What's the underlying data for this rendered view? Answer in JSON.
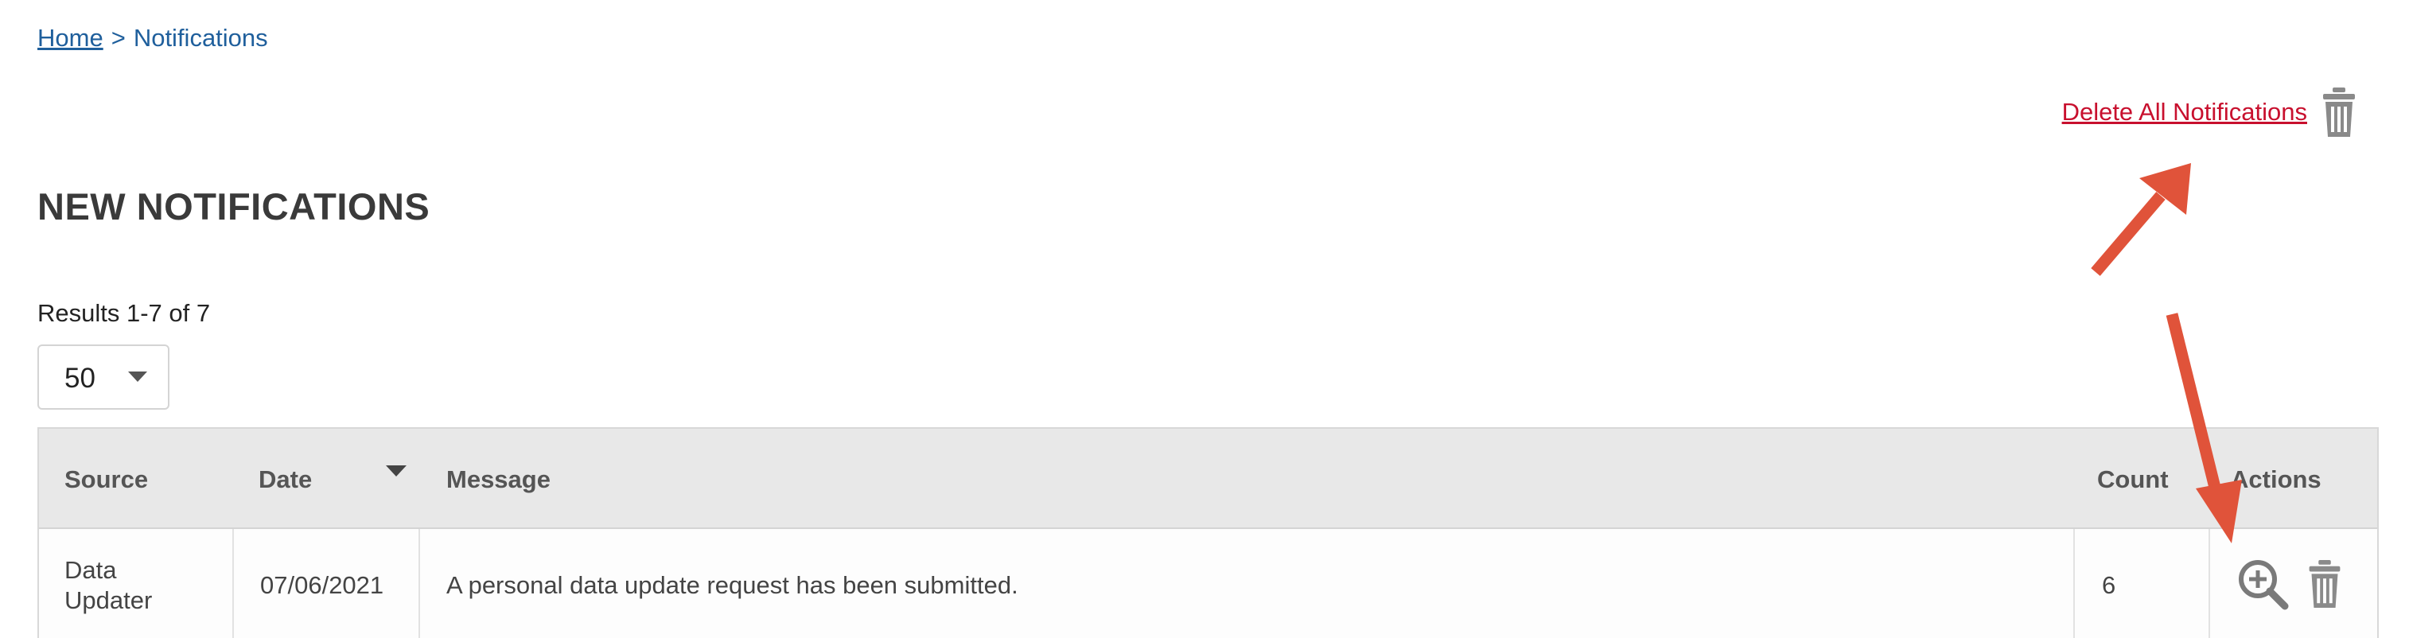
{
  "breadcrumb": {
    "home": "Home",
    "separator": ">",
    "current": "Notifications"
  },
  "delete_all_label": "Delete All Notifications",
  "page_title": "NEW NOTIFICATIONS",
  "results_text": "Results 1-7 of 7",
  "per_page": {
    "selected": "50"
  },
  "table": {
    "headers": {
      "source": "Source",
      "date": "Date",
      "message": "Message",
      "count": "Count",
      "actions": "Actions"
    },
    "rows": [
      {
        "source_line1": "Data",
        "source_line2": "Updater",
        "date": "07/06/2021",
        "message": "A personal data update request has been submitted.",
        "count": "6"
      }
    ]
  },
  "icons": [
    "trash-icon",
    "sort-desc-icon",
    "zoom-in-icon",
    "chevron-down-icon"
  ],
  "colors": {
    "link": "#1f5f9c",
    "danger": "#c8102e",
    "annotation_arrow": "#e0533a",
    "header_bg": "#e8e8e8"
  }
}
